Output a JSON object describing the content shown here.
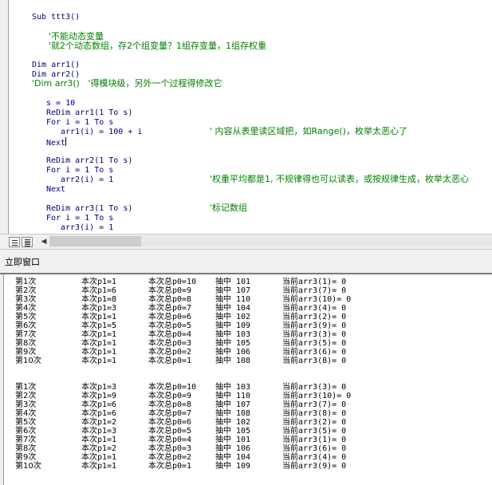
{
  "editor": {
    "lines": [
      {
        "type": "code",
        "text": "Sub ttt3()"
      },
      {
        "type": "comment",
        "text": "'不能动态变量"
      },
      {
        "type": "comment",
        "text": "'就2个动态数组，存2个组变量？1组存变量，1组存权重"
      },
      {
        "type": "code",
        "text": "Dim arr1()"
      },
      {
        "type": "code",
        "text": "Dim arr2()"
      },
      {
        "type": "comment",
        "text": "'Dim arr3()   '得模块级，另外一个过程得修改它"
      },
      {
        "type": "code",
        "text": "s = 10"
      },
      {
        "type": "code",
        "text": "ReDim arr1(1 To s)"
      },
      {
        "type": "code",
        "text": "For i = 1 To s"
      },
      {
        "type": "code",
        "text": "arr1(i) = 100 + i"
      },
      {
        "type": "comment",
        "text": "' 内容从表里读区域把，如Range()，枚举太恶心了"
      },
      {
        "type": "code",
        "text": "Next"
      },
      {
        "type": "code",
        "text": "ReDim arr2(1 To s)"
      },
      {
        "type": "code",
        "text": "For i = 1 To s"
      },
      {
        "type": "code",
        "text": "arr2(i) = 1"
      },
      {
        "type": "comment",
        "text": "'权重平均都是1, 不规律得也可以读表，或按规律生成，枚举太恶心"
      },
      {
        "type": "code",
        "text": "Next"
      },
      {
        "type": "code",
        "text": "ReDim arr3(1 To s)"
      },
      {
        "type": "comment",
        "text": "'标记数组"
      },
      {
        "type": "code",
        "text": "For i = 1 To s"
      },
      {
        "type": "code",
        "text": "arr3(i) = 1"
      }
    ]
  },
  "immediate": {
    "title": "立即窗口",
    "block1": [
      [
        "第1次",
        "本次p1=1",
        "本次总p0=10",
        "抽中 101",
        "当前arr3(1)= 0"
      ],
      [
        "第2次",
        "本次p1=6",
        "本次总p0=9",
        "抽中 107",
        "当前arr3(7)= 0"
      ],
      [
        "第3次",
        "本次p1=8",
        "本次总p0=8",
        "抽中 110",
        "当前arr3(10)= 0"
      ],
      [
        "第4次",
        "本次p1=3",
        "本次总p0=7",
        "抽中 104",
        "当前arr3(4)= 0"
      ],
      [
        "第5次",
        "本次p1=1",
        "本次总p0=6",
        "抽中 102",
        "当前arr3(2)= 0"
      ],
      [
        "第6次",
        "本次p1=5",
        "本次总p0=5",
        "抽中 109",
        "当前arr3(9)= 0"
      ],
      [
        "第7次",
        "本次p1=1",
        "本次总p0=4",
        "抽中 103",
        "当前arr3(3)= 0"
      ],
      [
        "第8次",
        "本次p1=1",
        "本次总p0=3",
        "抽中 105",
        "当前arr3(5)= 0"
      ],
      [
        "第9次",
        "本次p1=1",
        "本次总p0=2",
        "抽中 106",
        "当前arr3(6)= 0"
      ],
      [
        "第10次",
        "本次p1=1",
        "本次总p0=1",
        "抽中 108",
        "当前arr3(8)= 0"
      ]
    ],
    "block2": [
      [
        "第1次",
        "本次p1=3",
        "本次总p0=10",
        "抽中 103",
        "当前arr3(3)= 0"
      ],
      [
        "第2次",
        "本次p1=9",
        "本次总p0=9",
        "抽中 110",
        "当前arr3(10)= 0"
      ],
      [
        "第3次",
        "本次p1=6",
        "本次总p0=8",
        "抽中 107",
        "当前arr3(7)= 0"
      ],
      [
        "第4次",
        "本次p1=6",
        "本次总p0=7",
        "抽中 108",
        "当前arr3(8)= 0"
      ],
      [
        "第5次",
        "本次p1=2",
        "本次总p0=6",
        "抽中 102",
        "当前arr3(2)= 0"
      ],
      [
        "第6次",
        "本次p1=3",
        "本次总p0=5",
        "抽中 105",
        "当前arr3(5)= 0"
      ],
      [
        "第7次",
        "本次p1=1",
        "本次总p0=4",
        "抽中 101",
        "当前arr3(1)= 0"
      ],
      [
        "第8次",
        "本次p1=2",
        "本次总p0=3",
        "抽中 106",
        "当前arr3(6)= 0"
      ],
      [
        "第9次",
        "本次p1=1",
        "本次总p0=2",
        "抽中 104",
        "当前arr3(4)= 0"
      ],
      [
        "第10次",
        "本次p1=1",
        "本次总p0=1",
        "抽中 109",
        "当前arr3(9)= 0"
      ]
    ]
  }
}
